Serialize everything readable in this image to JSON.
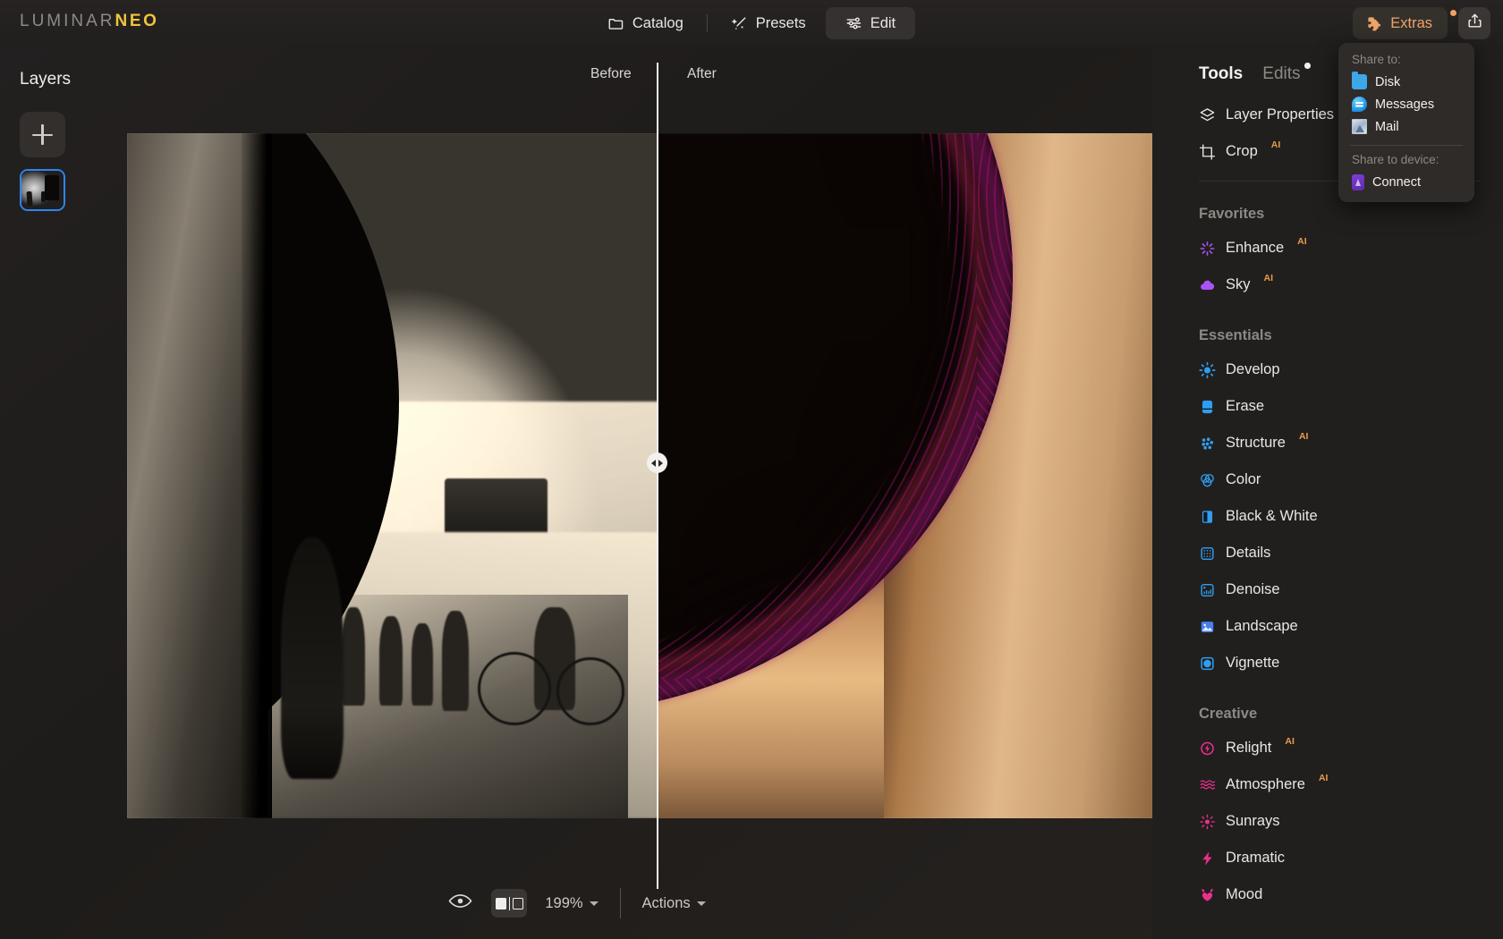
{
  "app": {
    "logo_primary": "LUMINAR",
    "logo_accent": "NEO"
  },
  "topnav": {
    "catalog": "Catalog",
    "presets": "Presets",
    "edit": "Edit",
    "extras": "Extras"
  },
  "share_menu": {
    "header_to": "Share to:",
    "header_device": "Share to device:",
    "items": [
      {
        "label": "Disk",
        "icon": "disk-folder-icon"
      },
      {
        "label": "Messages",
        "icon": "messages-icon"
      },
      {
        "label": "Mail",
        "icon": "mail-icon"
      }
    ],
    "device_items": [
      {
        "label": "Connect",
        "icon": "connect-icon"
      }
    ]
  },
  "layers": {
    "title": "Layers",
    "add_label": "+"
  },
  "canvas": {
    "before_label": "Before",
    "after_label": "After"
  },
  "bottombar": {
    "zoom": "199%",
    "actions": "Actions"
  },
  "rpanel": {
    "tabs": [
      {
        "label": "Tools",
        "active": true
      },
      {
        "label": "Edits",
        "active": false,
        "badge": true
      }
    ],
    "top_items": [
      {
        "label": "Layer Properties",
        "icon": "layers-icon",
        "ai": ""
      },
      {
        "label": "Crop",
        "icon": "crop-icon",
        "ai": "AI"
      }
    ],
    "sections": [
      {
        "title": "Favorites",
        "items": [
          {
            "label": "Enhance",
            "icon": "sparkle-icon",
            "ai": "AI",
            "color": "#a855f7"
          },
          {
            "label": "Sky",
            "icon": "cloud-icon",
            "ai": "AI",
            "color": "#a855f7"
          }
        ]
      },
      {
        "title": "Essentials",
        "items": [
          {
            "label": "Develop",
            "icon": "sun-icon",
            "ai": "",
            "color": "#2f9ef0"
          },
          {
            "label": "Erase",
            "icon": "eraser-icon",
            "ai": "",
            "color": "#2f9ef0"
          },
          {
            "label": "Structure",
            "icon": "dots-grid-icon",
            "ai": "AI",
            "color": "#2f9ef0"
          },
          {
            "label": "Color",
            "icon": "color-circles-icon",
            "ai": "",
            "color": "#2f9ef0"
          },
          {
            "label": "Black & White",
            "icon": "black-white-icon",
            "ai": "",
            "color": "#2f9ef0"
          },
          {
            "label": "Details",
            "icon": "details-icon",
            "ai": "",
            "color": "#2f9ef0"
          },
          {
            "label": "Denoise",
            "icon": "denoise-icon",
            "ai": "",
            "color": "#2f9ef0"
          },
          {
            "label": "Landscape",
            "icon": "landscape-icon",
            "ai": "",
            "color": "#4a7ef0"
          },
          {
            "label": "Vignette",
            "icon": "vignette-icon",
            "ai": "",
            "color": "#2f9ef0"
          }
        ]
      },
      {
        "title": "Creative",
        "items": [
          {
            "label": "Relight",
            "icon": "relight-icon",
            "ai": "AI",
            "color": "#ec2f8f"
          },
          {
            "label": "Atmosphere",
            "icon": "atmosphere-icon",
            "ai": "AI",
            "color": "#ec2f8f"
          },
          {
            "label": "Sunrays",
            "icon": "sunrays-icon",
            "ai": "",
            "color": "#ec2f8f"
          },
          {
            "label": "Dramatic",
            "icon": "dramatic-icon",
            "ai": "",
            "color": "#ec2f8f"
          },
          {
            "label": "Mood",
            "icon": "mood-icon",
            "ai": "",
            "color": "#ec2f8f"
          }
        ]
      }
    ]
  },
  "colors": {
    "accent_yellow": "#f1c33e",
    "accent_orange": "#efa46a",
    "ai_badge": "#e89a4e",
    "selection_blue": "#2f84ef",
    "purple": "#a855f7",
    "blue": "#2f9ef0",
    "pink": "#ec2f8f"
  }
}
